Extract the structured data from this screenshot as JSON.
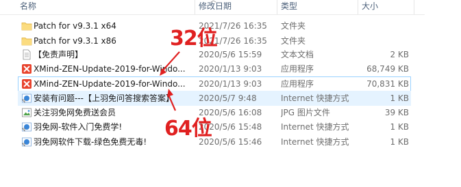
{
  "columns": {
    "name": "名称",
    "date": "修改日期",
    "type": "类型",
    "size": "大小"
  },
  "rows": [
    {
      "icon": "folder-icon",
      "name": "Patch for v9.3.1 x64",
      "date": "2021/7/26 16:35",
      "type": "文件夹",
      "size": ""
    },
    {
      "icon": "folder-icon",
      "name": "Patch for v9.3.1 x86",
      "date": "2021/7/26 16:35",
      "type": "文件夹",
      "size": ""
    },
    {
      "icon": "text-document-icon",
      "name": "【免责声明】",
      "date": "2020/5/6 15:59",
      "type": "文本文档",
      "size": "2 KB"
    },
    {
      "icon": "xmind-app-icon",
      "name": "XMind-ZEN-Update-2019-for-Windo...",
      "date": "2020/1/13 9:03",
      "type": "应用程序",
      "size": "68,749 KB"
    },
    {
      "icon": "xmind-app-icon",
      "name": "XMind-ZEN-Update-2019-for-Windo...",
      "date": "2020/1/13 9:03",
      "type": "应用程序",
      "size": "70,831 KB"
    },
    {
      "icon": "internet-shortcut-icon",
      "name": "安装有问题---【上羽免问答搜索答案】",
      "date": "2020/5/7 9:48",
      "type": "Internet 快捷方式",
      "size": "1 KB"
    },
    {
      "icon": "jpg-image-icon",
      "name": "关注羽免网免费送会员",
      "date": "2020/5/6 16:08",
      "type": "JPG 图片文件",
      "size": "39 KB"
    },
    {
      "icon": "internet-shortcut-icon",
      "name": "羽免网-软件入门免费学!",
      "date": "2020/5/6 15:48",
      "type": "Internet 快捷方式",
      "size": "1 KB"
    },
    {
      "icon": "internet-shortcut-icon",
      "name": "羽免网软件下载-绿色免费无毒!",
      "date": "2020/5/6 15:46",
      "type": "Internet 快捷方式",
      "size": "1 KB"
    }
  ],
  "annotations": {
    "label_32": "32位",
    "label_64": "64位",
    "color": "#e02020"
  },
  "colors": {
    "hover_bg": "#e5f3ff",
    "focus_border": "#99d1ff",
    "header_text": "#4c607a"
  }
}
